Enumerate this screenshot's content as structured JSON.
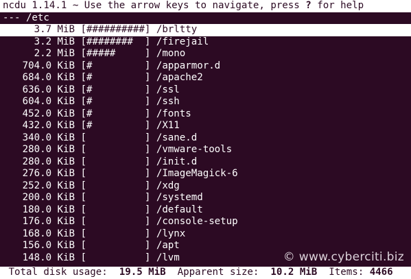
{
  "header": {
    "app": "ncdu 1.14.1",
    "hint_prefix": " ~ Use the arrow keys to navigate, press ",
    "hint_key": "?",
    "hint_suffix": " for help"
  },
  "path_line": "--- /etc ",
  "entries": [
    {
      "size": "3.7 MiB",
      "bar": "##########",
      "name": "/brltty",
      "selected": true
    },
    {
      "size": "3.2 MiB",
      "bar": "########  ",
      "name": "/firejail"
    },
    {
      "size": "2.2 MiB",
      "bar": "#####     ",
      "name": "/mono"
    },
    {
      "size": "704.0 KiB",
      "bar": "#         ",
      "name": "/apparmor.d"
    },
    {
      "size": "684.0 KiB",
      "bar": "#         ",
      "name": "/apache2"
    },
    {
      "size": "636.0 KiB",
      "bar": "#         ",
      "name": "/ssl"
    },
    {
      "size": "604.0 KiB",
      "bar": "#         ",
      "name": "/ssh"
    },
    {
      "size": "452.0 KiB",
      "bar": "#         ",
      "name": "/fonts"
    },
    {
      "size": "432.0 KiB",
      "bar": "#         ",
      "name": "/X11"
    },
    {
      "size": "340.0 KiB",
      "bar": "          ",
      "name": "/sane.d"
    },
    {
      "size": "280.0 KiB",
      "bar": "          ",
      "name": "/vmware-tools"
    },
    {
      "size": "280.0 KiB",
      "bar": "          ",
      "name": "/init.d"
    },
    {
      "size": "276.0 KiB",
      "bar": "          ",
      "name": "/ImageMagick-6"
    },
    {
      "size": "252.0 KiB",
      "bar": "          ",
      "name": "/xdg"
    },
    {
      "size": "200.0 KiB",
      "bar": "          ",
      "name": "/systemd"
    },
    {
      "size": "180.0 KiB",
      "bar": "          ",
      "name": "/default"
    },
    {
      "size": "176.0 KiB",
      "bar": "          ",
      "name": "/console-setup"
    },
    {
      "size": "168.0 KiB",
      "bar": "          ",
      "name": "/lynx"
    },
    {
      "size": "156.0 KiB",
      "bar": "          ",
      "name": "/apt"
    },
    {
      "size": "148.0 KiB",
      "bar": "          ",
      "name": "/lvm"
    }
  ],
  "footer": {
    "total_label": "Total disk usage:",
    "total_value": "19.5 MiB",
    "apparent_label": "Apparent size:",
    "apparent_value": "10.2 MiB",
    "items_label": "Items:",
    "items_value": "4466"
  },
  "watermark": "© www.cyberciti.biz",
  "colors": {
    "background": "#2c0a23",
    "foreground": "#ffffff"
  }
}
